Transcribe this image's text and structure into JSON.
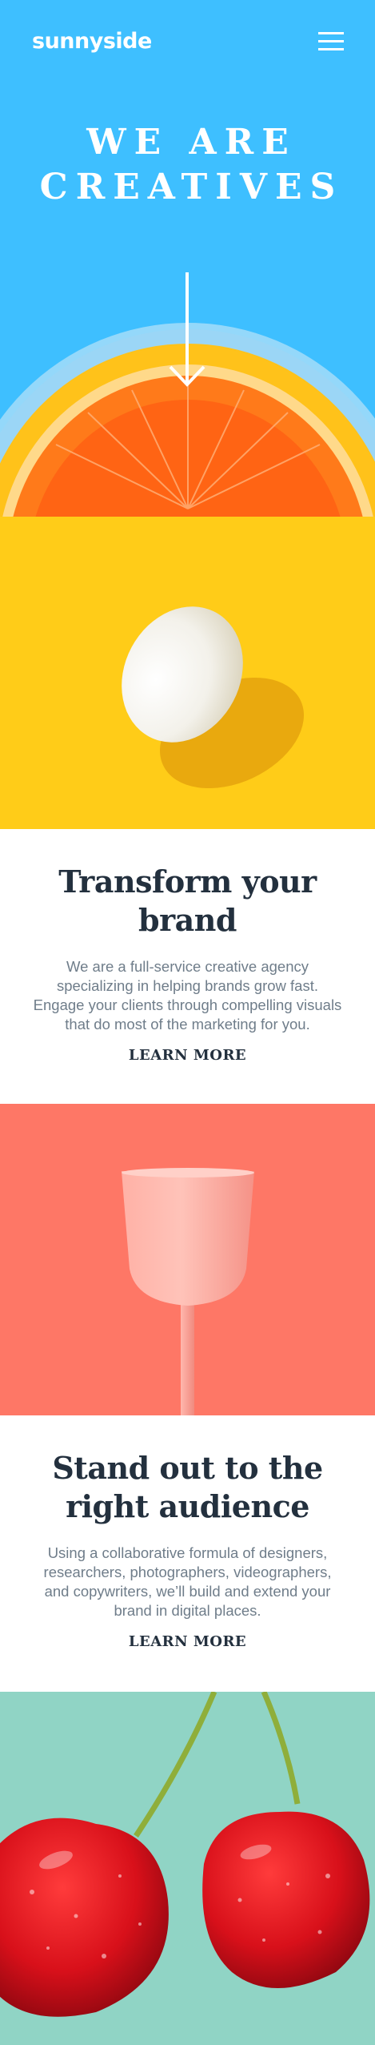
{
  "header": {
    "logo": "sunnyside",
    "menu_icon": "hamburger-menu-icon"
  },
  "hero": {
    "title_line1": "WE ARE",
    "title_line2": "CREATIVES",
    "arrow_icon": "arrow-down-icon"
  },
  "sections": {
    "transform": {
      "title_line1": "Transform your",
      "title_line2": "brand",
      "body_lines": [
        "We are a full-service creative agency",
        "specializing in helping brands grow fast.",
        "Engage your clients through compelling visuals",
        "that do most of the marketing for you."
      ],
      "cta": "LEARN MORE"
    },
    "standout": {
      "title_line1": "Stand out to the",
      "title_line2": "right audience",
      "body_lines": [
        "Using a collaborative formula of designers,",
        "researchers, photographers, videographers,",
        "and copywriters, we’ll build and extend your",
        "brand in digital places."
      ],
      "cta": "LEARN MORE"
    }
  },
  "colors": {
    "hero_bg": "#3ebfff",
    "egg_bg": "#ffcc18",
    "glass_bg": "#fe7766",
    "cherry_bg": "#90d4c5",
    "heading": "#23303e",
    "body": "#6f7d8a",
    "underline_yellow": "#fbe285",
    "underline_pink": "#f6c1b6"
  }
}
